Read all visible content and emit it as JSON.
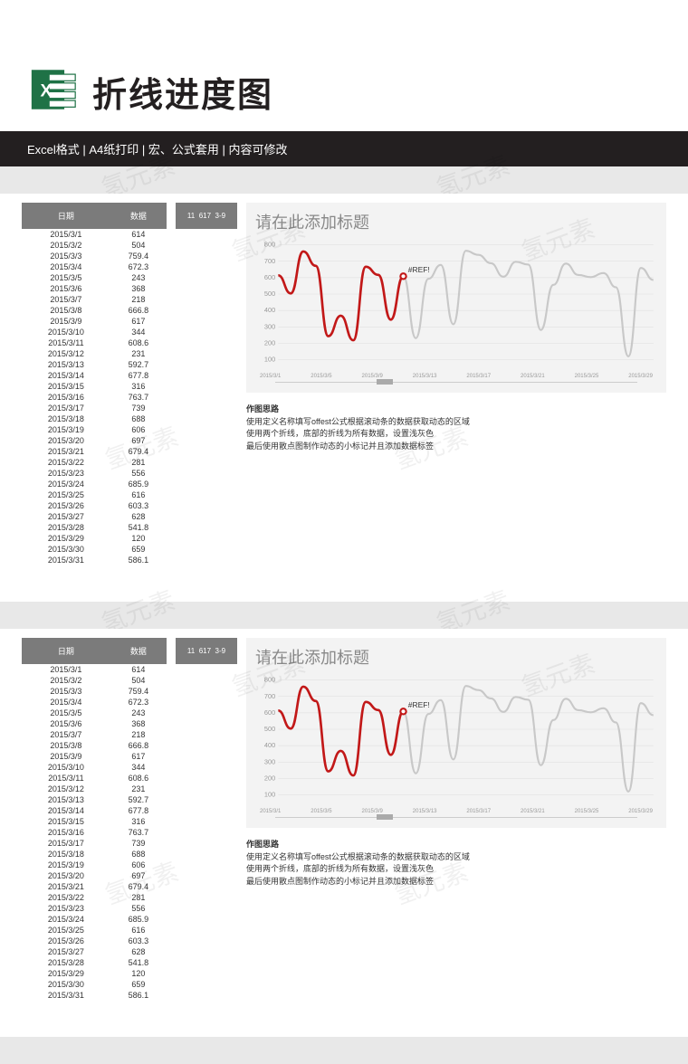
{
  "header": {
    "main_title": "折线进度图",
    "sub_line": "Excel格式 |  A4纸打印 |  宏、公式套用 |  内容可修改"
  },
  "watermark_text": "氢元素",
  "table": {
    "col_date": "日期",
    "col_value": "数据",
    "rows": [
      {
        "d": "2015/3/1",
        "v": 614
      },
      {
        "d": "2015/3/2",
        "v": 504
      },
      {
        "d": "2015/3/3",
        "v": 759.4
      },
      {
        "d": "2015/3/4",
        "v": 672.3
      },
      {
        "d": "2015/3/5",
        "v": 243
      },
      {
        "d": "2015/3/6",
        "v": 368
      },
      {
        "d": "2015/3/7",
        "v": 218
      },
      {
        "d": "2015/3/8",
        "v": 666.8
      },
      {
        "d": "2015/3/9",
        "v": 617
      },
      {
        "d": "2015/3/10",
        "v": 344
      },
      {
        "d": "2015/3/11",
        "v": 608.6
      },
      {
        "d": "2015/3/12",
        "v": 231
      },
      {
        "d": "2015/3/13",
        "v": 592.7
      },
      {
        "d": "2015/3/14",
        "v": 677.8
      },
      {
        "d": "2015/3/15",
        "v": 316
      },
      {
        "d": "2015/3/16",
        "v": 763.7
      },
      {
        "d": "2015/3/17",
        "v": 739
      },
      {
        "d": "2015/3/18",
        "v": 688
      },
      {
        "d": "2015/3/19",
        "v": 606
      },
      {
        "d": "2015/3/20",
        "v": 697
      },
      {
        "d": "2015/3/21",
        "v": 679.4
      },
      {
        "d": "2015/3/22",
        "v": 281
      },
      {
        "d": "2015/3/23",
        "v": 556
      },
      {
        "d": "2015/3/24",
        "v": 685.9
      },
      {
        "d": "2015/3/25",
        "v": 616
      },
      {
        "d": "2015/3/26",
        "v": 603.3
      },
      {
        "d": "2015/3/27",
        "v": 628
      },
      {
        "d": "2015/3/28",
        "v": 541.8
      },
      {
        "d": "2015/3/29",
        "v": 120
      },
      {
        "d": "2015/3/30",
        "v": 659
      },
      {
        "d": "2015/3/31",
        "v": 586.1
      }
    ]
  },
  "mid_box": {
    "a": "11",
    "b": "617",
    "c": "3-9"
  },
  "chart_data": {
    "type": "line",
    "title": "请在此添加标题",
    "xlabel": "",
    "ylabel": "",
    "ylim": [
      100,
      800
    ],
    "yticks": [
      100,
      200,
      300,
      400,
      500,
      600,
      700,
      800
    ],
    "x": [
      "2015/3/1",
      "2015/3/2",
      "2015/3/3",
      "2015/3/4",
      "2015/3/5",
      "2015/3/6",
      "2015/3/7",
      "2015/3/8",
      "2015/3/9",
      "2015/3/10",
      "2015/3/11",
      "2015/3/12",
      "2015/3/13",
      "2015/3/14",
      "2015/3/15",
      "2015/3/16",
      "2015/3/17",
      "2015/3/18",
      "2015/3/19",
      "2015/3/20",
      "2015/3/21",
      "2015/3/22",
      "2015/3/23",
      "2015/3/24",
      "2015/3/25",
      "2015/3/26",
      "2015/3/27",
      "2015/3/28",
      "2015/3/29",
      "2015/3/30",
      "2015/3/31"
    ],
    "xticks": [
      "2015/3/1",
      "2015/3/5",
      "2015/3/9",
      "2015/3/13",
      "2015/3/17",
      "2015/3/21",
      "2015/3/25",
      "2015/3/29"
    ],
    "series": [
      {
        "name": "full",
        "role": "background",
        "color": "#c8c8c8",
        "values": [
          614,
          504,
          759.4,
          672.3,
          243,
          368,
          218,
          666.8,
          617,
          344,
          608.6,
          231,
          592.7,
          677.8,
          316,
          763.7,
          739,
          688,
          606,
          697,
          679.4,
          281,
          556,
          685.9,
          616,
          603.3,
          628,
          541.8,
          120,
          659,
          586.1
        ]
      },
      {
        "name": "active",
        "role": "highlight",
        "color": "#c21818",
        "active_count": 11,
        "values": [
          614,
          504,
          759.4,
          672.3,
          243,
          368,
          218,
          666.8,
          617,
          344,
          608.6
        ]
      }
    ],
    "marker": {
      "index": 10,
      "value": 608.6,
      "label": "#REF!"
    }
  },
  "notes": {
    "title": "作图思路",
    "line1": "使用定义名称填写offest公式根据滚动条的数据获取动态的区域",
    "line2": "使用两个折线，底部的折线为所有数据，设置浅灰色",
    "line3": "最后使用散点图制作动态的小标记并且添加数据标签"
  }
}
